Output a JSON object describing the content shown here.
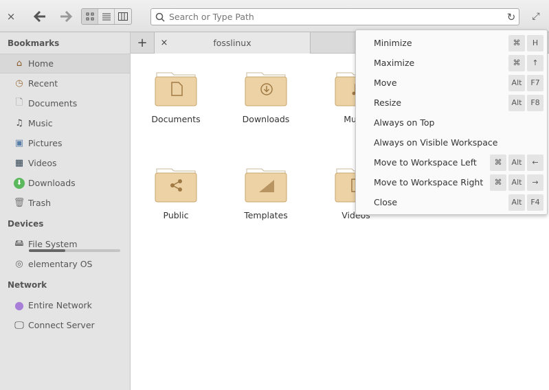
{
  "toolbar": {
    "close": "×",
    "back": "🡐",
    "forward": "🡒",
    "view_icons": "▫▫",
    "view_list": "≡",
    "view_columns": "▥",
    "search_placeholder": "Search or Type Path",
    "reload": "↻",
    "maximize": "⤢"
  },
  "sidebar": {
    "bookmarks_title": "Bookmarks",
    "bookmarks": [
      {
        "label": "Home",
        "icon": "home-icon"
      },
      {
        "label": "Recent",
        "icon": "recent-icon"
      },
      {
        "label": "Documents",
        "icon": "document-icon"
      },
      {
        "label": "Music",
        "icon": "music-icon"
      },
      {
        "label": "Pictures",
        "icon": "pictures-icon"
      },
      {
        "label": "Videos",
        "icon": "videos-icon"
      },
      {
        "label": "Downloads",
        "icon": "downloads-icon"
      },
      {
        "label": "Trash",
        "icon": "trash-icon"
      }
    ],
    "devices_title": "Devices",
    "devices": [
      {
        "label": "File System",
        "icon": "drive-icon",
        "usage_percent": 40
      },
      {
        "label": "elementary OS",
        "icon": "disc-icon"
      }
    ],
    "network_title": "Network",
    "network": [
      {
        "label": "Entire Network",
        "icon": "network-icon"
      },
      {
        "label": "Connect Server",
        "icon": "server-icon"
      }
    ]
  },
  "tabs": {
    "new": "+",
    "items": [
      {
        "label": "fosslinux",
        "close": "×"
      }
    ]
  },
  "files": [
    {
      "label": "Documents",
      "emblem": "document"
    },
    {
      "label": "Downloads",
      "emblem": "download"
    },
    {
      "label": "Music",
      "emblem": "music"
    },
    {
      "label": "Public",
      "emblem": "share"
    },
    {
      "label": "Templates",
      "emblem": "template"
    },
    {
      "label": "Videos",
      "emblem": "video"
    }
  ],
  "context_menu": [
    {
      "label": "Minimize",
      "keys": [
        "⌘",
        "H"
      ]
    },
    {
      "label": "Maximize",
      "keys": [
        "⌘",
        "↑"
      ]
    },
    {
      "label": "Move",
      "keys": [
        "Alt",
        "F7"
      ]
    },
    {
      "label": "Resize",
      "keys": [
        "Alt",
        "F8"
      ]
    },
    {
      "label": "Always on Top",
      "keys": []
    },
    {
      "label": "Always on Visible Workspace",
      "keys": []
    },
    {
      "label": "Move to Workspace Left",
      "keys": [
        "⌘",
        "Alt",
        "←"
      ]
    },
    {
      "label": "Move to Workspace Right",
      "keys": [
        "⌘",
        "Alt",
        "→"
      ]
    },
    {
      "label": "Close",
      "keys": [
        "Alt",
        "F4"
      ]
    }
  ]
}
